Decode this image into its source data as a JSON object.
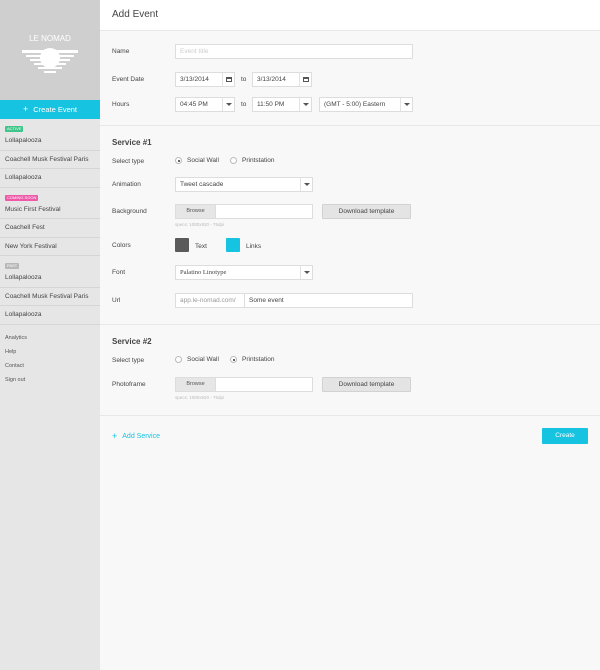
{
  "app": {
    "logo_text": "LE NOMAD",
    "create_event_label": "Create Event"
  },
  "sidebar": {
    "groups": [
      {
        "badge": "Active",
        "items": [
          "Lollapalooza",
          "Coachell Musk Festival Paris",
          "Lollapalooza"
        ]
      },
      {
        "badge": "Coming soon",
        "items": [
          "Music First Festival",
          "Coachell Fest",
          "New York Festival"
        ]
      },
      {
        "badge": "Past",
        "items": [
          "Lollapalooza",
          "Coachell Musk Festival Paris",
          "Lollapalooza"
        ]
      }
    ],
    "links": [
      "Analytics",
      "Help",
      "Contact",
      "Sign out"
    ]
  },
  "page": {
    "title": "Add Event"
  },
  "form": {
    "name_label": "Name",
    "name_placeholder": "Event title",
    "date_label": "Event Date",
    "date_start": "3/13/2014",
    "date_to": "to",
    "date_end": "3/13/2014",
    "hours_label": "Hours",
    "hour_start": "04:45 PM",
    "hour_to": "to",
    "hour_end": "11:50 PM",
    "timezone": "(GMT - 5:00) Eastern"
  },
  "service1": {
    "title": "Service #1",
    "select_type_label": "Select type",
    "option_social": "Social Wall",
    "option_print": "Printstation",
    "selected": "Social Wall",
    "animation_label": "Animation",
    "animation_value": "Tweet cascade",
    "background_label": "Background",
    "browse_label": "Browse",
    "specs": "specs: 1080x920 - 75dpi",
    "download_label": "Download template",
    "colors_label": "Colors",
    "color_text_label": "Text",
    "color_links_label": "Links",
    "color_text": "#5a5a5a",
    "color_links": "#16c3e0",
    "font_label": "Font",
    "font_value": "Palatino Linotype",
    "url_label": "Url",
    "url_prefix": "app.le-nomad.com/",
    "url_value": "Some event"
  },
  "service2": {
    "title": "Service #2",
    "select_type_label": "Select type",
    "option_social": "Social Wall",
    "option_print": "Printstation",
    "selected": "Printstation",
    "photoframe_label": "Photoframe",
    "browse_label": "Browse",
    "specs": "specs: 1080x920 - 75dpi",
    "download_label": "Download template"
  },
  "actions": {
    "add_service_label": "Add Service",
    "create_label": "Create"
  },
  "colors": {
    "accent": "#16c3e0",
    "badge_active": "#3fc48a",
    "badge_soon": "#ef5aa8",
    "badge_past": "#b8b8b8"
  }
}
